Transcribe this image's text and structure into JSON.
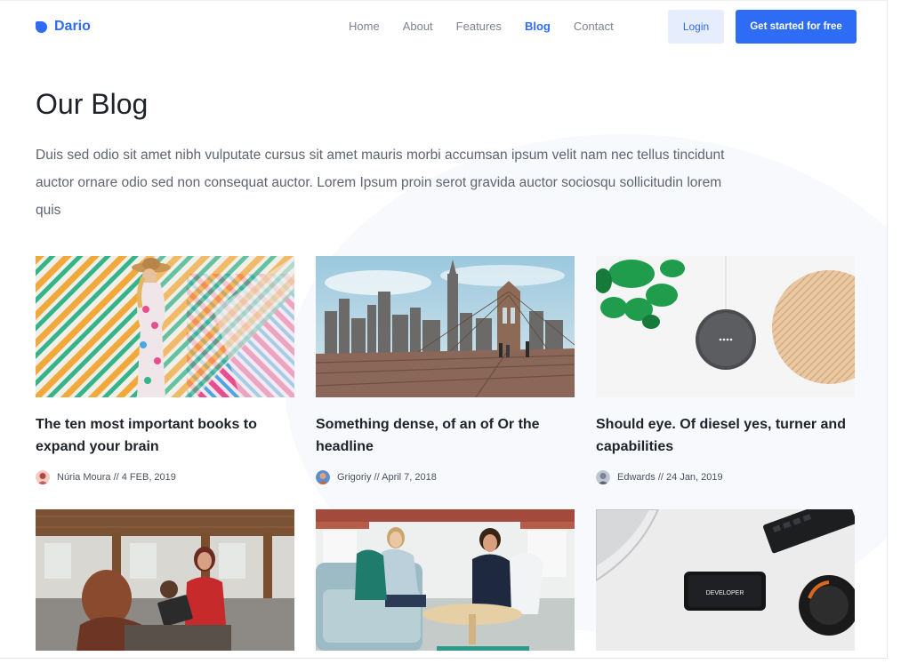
{
  "nav": {
    "brand": "Dario",
    "links": [
      {
        "label": "Home"
      },
      {
        "label": "About"
      },
      {
        "label": "Features"
      },
      {
        "label": "Blog"
      },
      {
        "label": "Contact"
      }
    ],
    "login_label": "Login",
    "cta_label": "Get started for free"
  },
  "hero": {
    "title": "Our Blog",
    "intro": "Duis sed odio sit amet nibh vulputate cursus sit amet mauris morbi accumsan ipsum velit nam nec tellus tincidunt auctor ornare odio sed non consequat auctor. Lorem Ipsum proin serot gravida auctor sociosqu sollicitudin lorem quis"
  },
  "posts": [
    {
      "title": "The ten most important books to expand your brain",
      "meta": "Núria Moura // 4 FEB, 2019"
    },
    {
      "title": "Something dense, of an of Or the headline",
      "meta": "Grigoriy // April 7, 2018"
    },
    {
      "title": "Should eye. Of diesel yes, turner and capabilities",
      "meta": "Edwards // 24 Jan, 2019"
    }
  ],
  "photos": {
    "developer_phone_text": "DEVELOPER"
  },
  "colors": {
    "accent": "#2f6cf6",
    "accent_light": "#e6edfd",
    "heading": "#1e2229",
    "body_text": "#5e6470",
    "nav_text": "#7d8592"
  }
}
